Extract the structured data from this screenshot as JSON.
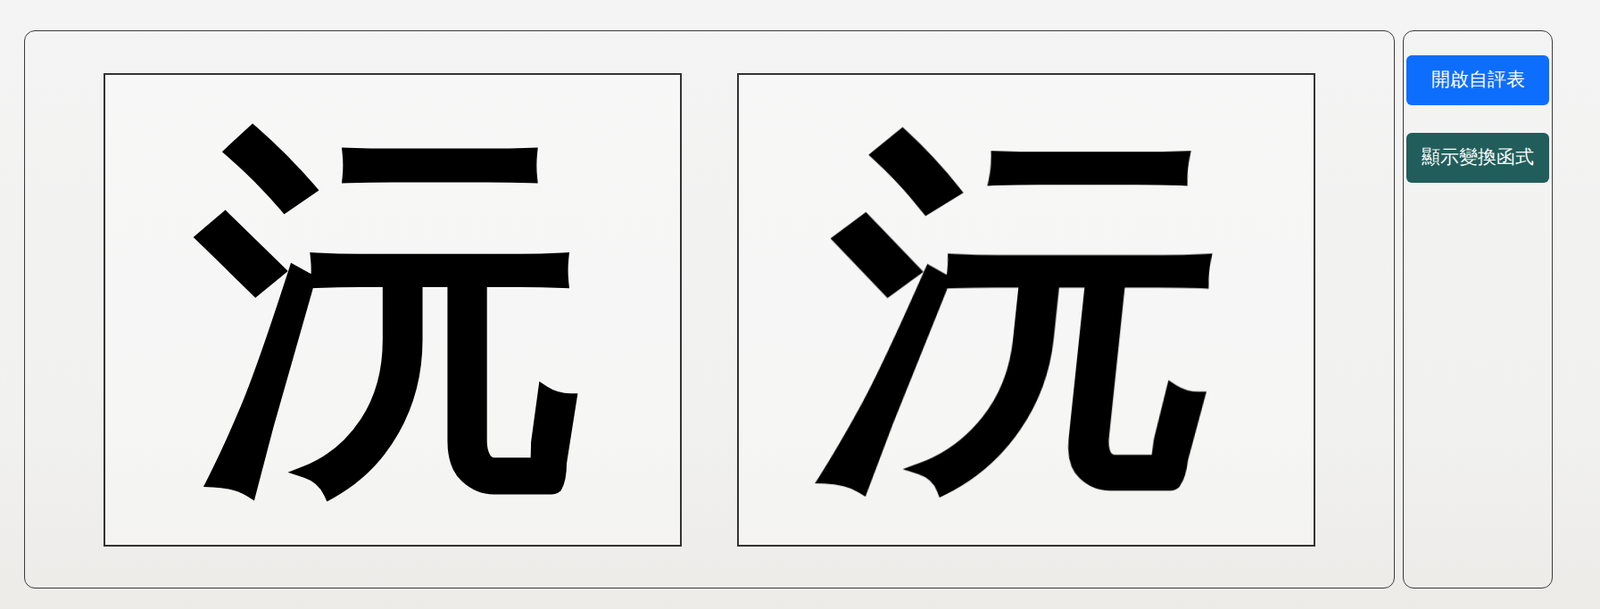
{
  "workspace": {
    "panels": [
      {
        "character": "沅",
        "kind": "original"
      },
      {
        "character": "沅",
        "kind": "transformed"
      }
    ]
  },
  "sidebar": {
    "buttons": [
      {
        "label": "開啟自評表",
        "color": "#0d6efd"
      },
      {
        "label": "顯示變換函式",
        "color": "#215e5b"
      }
    ]
  }
}
